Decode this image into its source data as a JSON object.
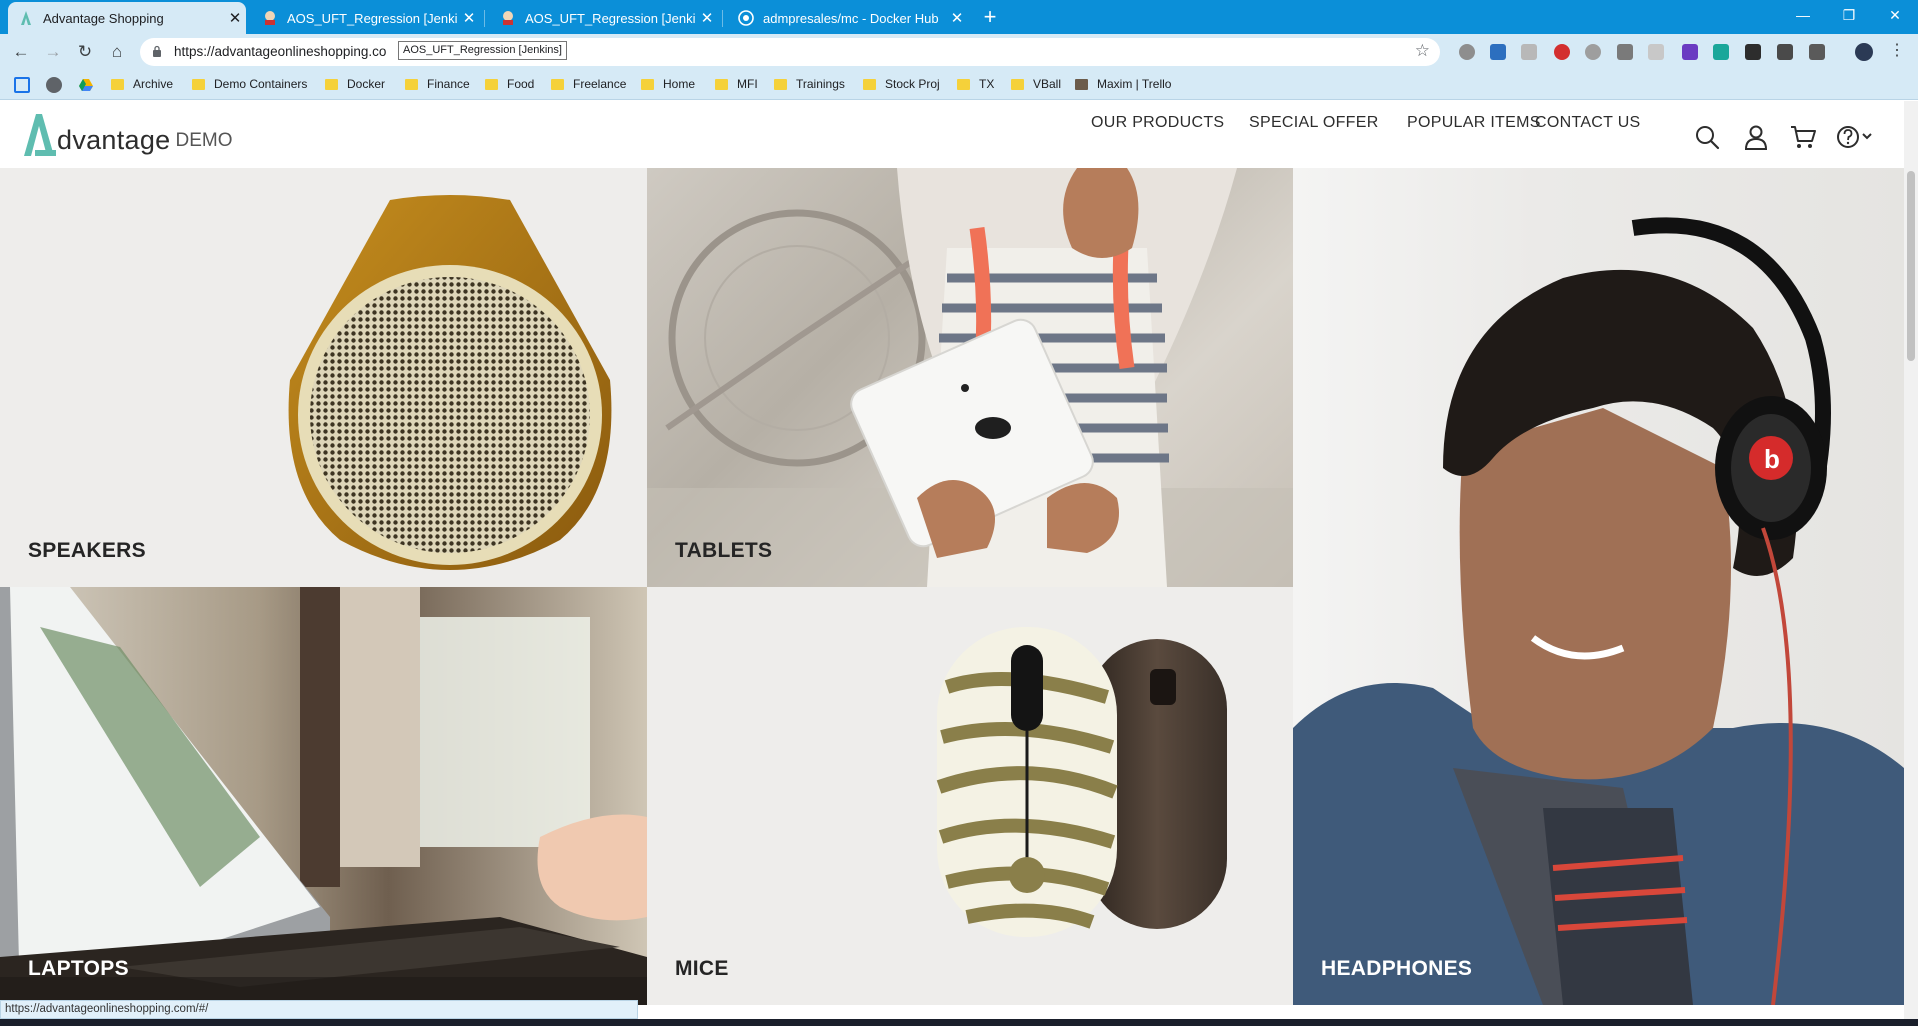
{
  "browser": {
    "tabs": [
      {
        "title": "Advantage Shopping",
        "favicon": "advantage-logo-icon",
        "active": true
      },
      {
        "title": "AOS_UFT_Regression [Jenkins]",
        "favicon": "jenkins-icon",
        "active": false
      },
      {
        "title": "AOS_UFT_Regression [Jenkins]",
        "favicon": "jenkins-icon",
        "active": false
      },
      {
        "title": "admpresales/mc - Docker Hub",
        "favicon": "docker-icon",
        "active": false
      }
    ],
    "url": "https://advantageonlineshopping.co",
    "url_tooltip": "AOS_UFT_Regression [Jenkins]",
    "status_url": "https://advantageonlineshopping.com/#/",
    "bookmarks": [
      "Archive",
      "Demo Containers",
      "Docker",
      "Finance",
      "Food",
      "Freelance",
      "Home",
      "MFI",
      "Trainings",
      "Stock Proj",
      "TX",
      "VBall",
      "Maxim | Trello"
    ],
    "colors": {
      "tabbar": "#0b8fd8",
      "toolbar": "#d6eaf6"
    }
  },
  "site": {
    "logo_text": "dvantage",
    "logo_sub": "DEMO",
    "nav": [
      "OUR PRODUCTS",
      "SPECIAL OFFER",
      "POPULAR ITEMS",
      "CONTACT US"
    ],
    "icons": [
      "search-icon",
      "user-icon",
      "cart-icon",
      "help-icon"
    ],
    "accent_color": "#5fbdb0"
  },
  "categories": [
    {
      "label": "SPEAKERS"
    },
    {
      "label": "TABLETS"
    },
    {
      "label": "HEADPHONES"
    },
    {
      "label": "LAPTOPS"
    },
    {
      "label": "MICE"
    }
  ]
}
